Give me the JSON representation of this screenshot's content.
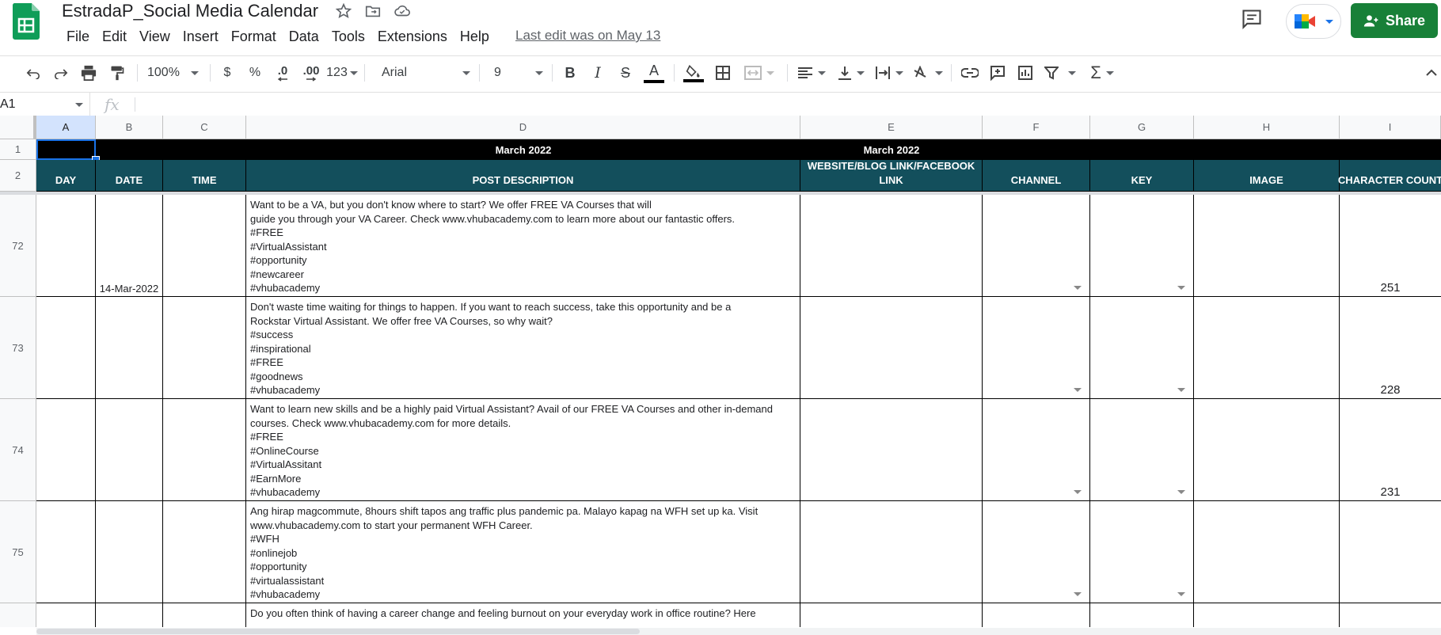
{
  "app": {
    "doc_title": "EstradaP_Social Media Calendar",
    "menu": [
      "File",
      "Edit",
      "View",
      "Insert",
      "Format",
      "Data",
      "Tools",
      "Extensions",
      "Help"
    ],
    "last_edit": "Last edit was on May 13",
    "share_label": "Share"
  },
  "toolbar": {
    "zoom": "100%",
    "currency": "$",
    "percent": "%",
    "dec_decrease": ".0",
    "dec_increase": ".00",
    "more_formats": "123",
    "font": "Arial",
    "font_size": "9",
    "bold": "B",
    "italic": "I",
    "strike": "S",
    "text_color": "A"
  },
  "formula_bar": {
    "cell_ref": "A1",
    "fx": "fx",
    "value": ""
  },
  "grid": {
    "columns": [
      "A",
      "B",
      "C",
      "D",
      "E",
      "F",
      "G",
      "H",
      "I"
    ],
    "banner_d": "March 2022",
    "banner_e": "March 2022",
    "headers": [
      "DAY",
      "DATE",
      "TIME",
      "POST DESCRIPTION",
      "WEBSITE/BLOG LINK/FACEBOOK\nLINK",
      "CHANNEL",
      "KEY",
      "IMAGE",
      "CHARACTER COUNT"
    ],
    "row_numbers": [
      "1",
      "2"
    ],
    "rows": [
      {
        "num": "72",
        "date": "14-Mar-2022",
        "desc": "Want to be a VA, but you don't know where to start? We offer FREE VA Courses that will\nguide you through your VA Career. Check www.vhubacademy.com to learn more about our fantastic offers.\n#FREE\n#VirtualAssistant\n#opportunity\n#newcareer\n#vhubacademy",
        "count": "251"
      },
      {
        "num": "73",
        "date": "",
        "desc": "Don't waste time waiting for things to happen. If you want to reach success, take this opportunity and be a\nRockstar Virtual Assistant. We offer free VA Courses, so why wait?\n#success\n#inspirational\n#FREE\n#goodnews\n#vhubacademy",
        "count": "228"
      },
      {
        "num": "74",
        "date": "",
        "desc": "Want to learn new skills and be a highly paid Virtual Assistant? Avail of our FREE VA Courses and other in-demand\ncourses. Check www.vhubacademy.com for more details.\n#FREE\n#OnlineCourse\n#VirtualAssitant\n#EarnMore\n#vhubacademy",
        "count": "231"
      },
      {
        "num": "75",
        "date": "",
        "desc": "Ang hirap magcommute, 8hours shift tapos ang traffic plus pandemic pa. Malayo kapag na WFH set up ka. Visit\nwww.vhubacademy.com to start your permanent WFH Career.\n#WFH\n#onlinejob\n#opportunity\n#virtualassistant\n#vhubacademy",
        "count": ""
      },
      {
        "num": "",
        "date": "",
        "desc": "Do you often think of having a career change and feeling burnout on your everyday work in office routine? Here",
        "count": ""
      }
    ]
  },
  "colors": {
    "header_teal": "#134f5c",
    "banner": "#000000",
    "share_green": "#188038",
    "selection": "#1a73e8"
  }
}
